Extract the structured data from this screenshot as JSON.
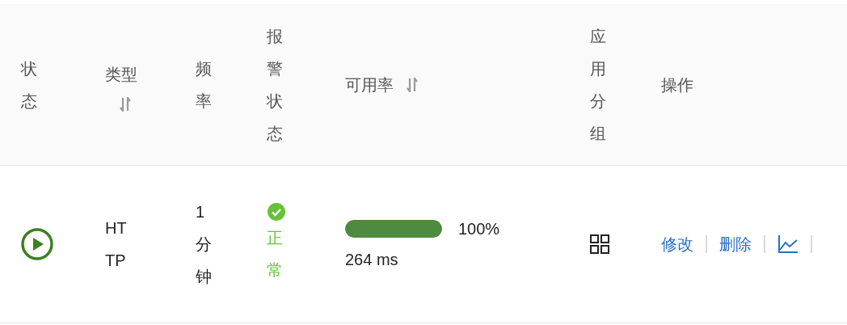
{
  "table": {
    "columns": [
      {
        "label": "状态",
        "sortable": false
      },
      {
        "label": "类型",
        "sortable": true
      },
      {
        "label": "频率",
        "sortable": false
      },
      {
        "label": "报警状态",
        "sortable": false
      },
      {
        "label": "可用率",
        "sortable": true
      },
      {
        "label": "应用分组",
        "sortable": false
      },
      {
        "label": "操作",
        "sortable": false
      }
    ],
    "rows": [
      {
        "type": "HTTP",
        "frequency": "1分钟",
        "alert": {
          "kind": "ok",
          "label": "正常"
        },
        "availability": {
          "level": 1,
          "percent": "100%",
          "latency": "264 ms"
        },
        "actions": [
          {
            "kind": "link",
            "label": "修改"
          },
          {
            "kind": "link",
            "label": "删除"
          },
          {
            "kind": "chart"
          }
        ]
      }
    ]
  }
}
